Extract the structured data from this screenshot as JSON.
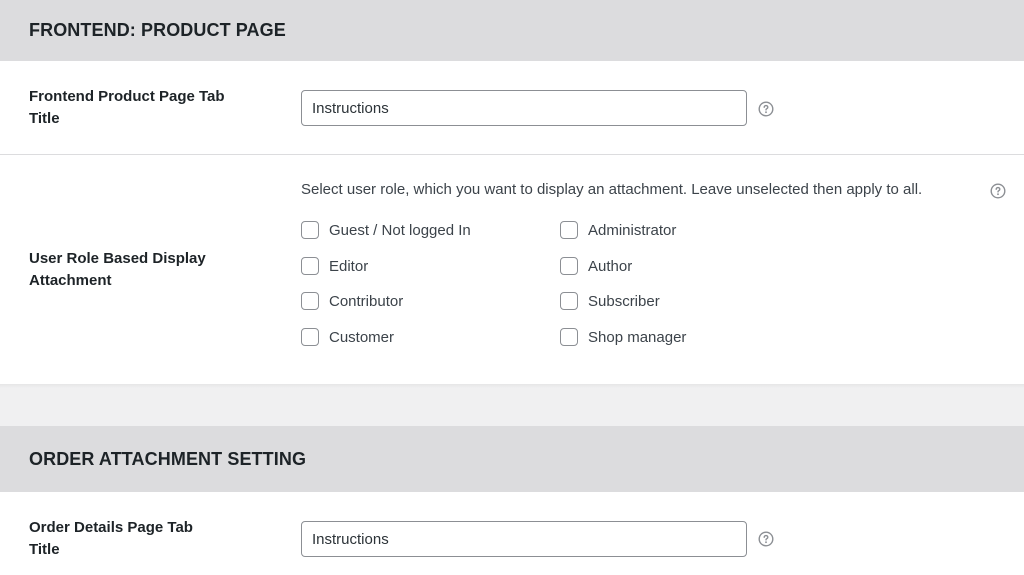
{
  "sections": [
    {
      "header": "FRONTEND: PRODUCT PAGE",
      "tab_title": {
        "label": "Frontend Product Page Tab Title",
        "value": "Instructions"
      },
      "user_role": {
        "label": "User Role Based Display Attachment",
        "description": "Select user role, which you want to display an attachment. Leave unselected then apply to all.",
        "roles": [
          {
            "label": "Guest / Not logged In",
            "checked": false
          },
          {
            "label": "Administrator",
            "checked": false
          },
          {
            "label": "Editor",
            "checked": false
          },
          {
            "label": "Author",
            "checked": false
          },
          {
            "label": "Contributor",
            "checked": false
          },
          {
            "label": "Subscriber",
            "checked": false
          },
          {
            "label": "Customer",
            "checked": false
          },
          {
            "label": "Shop manager",
            "checked": false
          }
        ]
      }
    },
    {
      "header": "ORDER ATTACHMENT SETTING",
      "tab_title": {
        "label": "Order Details Page Tab Title",
        "value": "Instructions"
      }
    }
  ],
  "icons": {
    "help": "help-circle-icon",
    "checkbox": "checkbox-unchecked-icon"
  },
  "colors": {
    "header_bg": "#dcdcde",
    "page_bg": "#f0f0f1",
    "panel_bg": "#ffffff",
    "border": "#8c8f94"
  }
}
